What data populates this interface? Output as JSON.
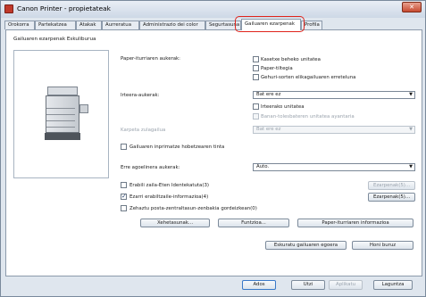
{
  "window": {
    "title": "Canon Printer - propietateak",
    "close_glyph": "✕"
  },
  "tabs": [
    {
      "label": "Orokorra"
    },
    {
      "label": "Partekatzea"
    },
    {
      "label": "Atakak"
    },
    {
      "label": "Aurreratua"
    },
    {
      "label": "Administrazio dei color"
    },
    {
      "label": "Segurtasuna"
    },
    {
      "label": "Gailuaren ezarpenak"
    },
    {
      "label": "Profila"
    }
  ],
  "panel": {
    "section_title": "Gailuaren ezarpenak Eskuliburua",
    "paper_feed": {
      "label": "Paper-iturriaren aukerak:",
      "options": [
        {
          "label": "Kasetxe beheko unitatea",
          "checked": false
        },
        {
          "label": "Paper-tiltegia",
          "checked": false
        },
        {
          "label": "Gehuri-sorten elikagailuaren erreteluna",
          "checked": false
        }
      ]
    },
    "output": {
      "label": "Irteera-aukerak:",
      "select_value": "Bat ere ez",
      "options": [
        {
          "label": "Irteerako unitatea",
          "checked": false,
          "disabled": false
        },
        {
          "label": "Banan-tolesbateren unitatea ayantaria",
          "checked": false,
          "disabled": true
        }
      ]
    },
    "punch": {
      "label": "Karpeta zulagailua",
      "select_value": "Bat ere ez"
    },
    "stamp": {
      "label": "Gailuaren inprimatze hobetzearen tinta",
      "checked": false
    },
    "job_mgmt": {
      "label": "Erre agoelinera aukerak:",
      "select_value": "Auto."
    },
    "checks": [
      {
        "label": "Erabili zaila-Eten Identekatuta(3)",
        "checked": false,
        "button": "Ezarpenak(5)...",
        "button_disabled": true
      },
      {
        "label": "Ezarri erabiltzaile-informazioa(4)",
        "checked": true,
        "button": "Ezarpenak(5)...",
        "button_disabled": false
      },
      {
        "label": "Zehaztu posta-zentraltasun-zenbakia gordeizkean(0)",
        "checked": false,
        "button": "",
        "button_disabled": false
      }
    ],
    "row_buttons": [
      {
        "label": "Xehetasunak..."
      },
      {
        "label": "Funtzioa..."
      },
      {
        "label": "Paper-iturriaren informazioa"
      }
    ],
    "bottom_buttons": [
      {
        "label": "Eskuratu gailuaren egoera"
      },
      {
        "label": "Honi buruz"
      }
    ]
  },
  "dialog_buttons": [
    {
      "label": "Ados"
    },
    {
      "label": "Utzi"
    },
    {
      "label": "Aplikatu"
    },
    {
      "label": "Laguntza"
    }
  ],
  "colors": {
    "highlight": "#e0241b",
    "panel_bg": "#ffffff",
    "window_bg": "#dfe6ee"
  }
}
